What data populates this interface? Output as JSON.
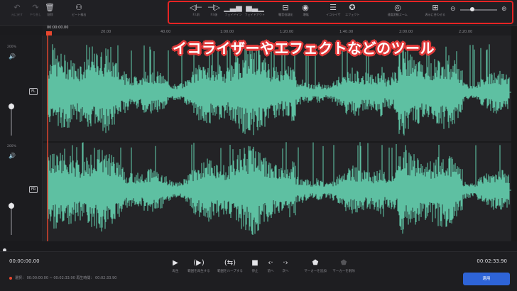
{
  "toolbar": {
    "left_buttons": [
      {
        "icon": "undo-icon",
        "label": "元に戻す",
        "glyph": "↶",
        "enabled": false
      },
      {
        "icon": "redo-icon",
        "label": "やり直し",
        "glyph": "↷",
        "enabled": false
      },
      {
        "icon": "delete-icon",
        "label": "削除",
        "glyph": "🗑",
        "enabled": true
      },
      {
        "icon": "beat-detect-icon",
        "label": "ビート検出",
        "glyph": "⚇",
        "enabled": true
      }
    ],
    "tools": [
      {
        "icon": "fade-in-icon",
        "label": "F.I.前",
        "glyph": "◁⊢"
      },
      {
        "icon": "fade-out-icon",
        "label": "F.I.後",
        "glyph": "⊣▷"
      },
      {
        "icon": "fade-in-curve-icon",
        "label": "フェイドイン",
        "glyph": "▁▃▅"
      },
      {
        "icon": "fade-out-curve-icon",
        "label": "フェイドアウト",
        "glyph": "▅▃▁"
      },
      {
        "icon": "noise-reduce-icon",
        "label": "騒音低減化",
        "glyph": "⊟"
      },
      {
        "icon": "amplify-icon",
        "label": "増幅",
        "glyph": "◉"
      },
      {
        "icon": "equalizer-icon",
        "label": "イコライザ",
        "glyph": "☰"
      },
      {
        "icon": "effect-icon",
        "label": "エフェクト",
        "glyph": "✪"
      },
      {
        "icon": "pitch-icon",
        "label": "速度変動ズーム",
        "glyph": "◎"
      },
      {
        "icon": "fit-icon",
        "label": "表示に合わせる",
        "glyph": "⊞"
      }
    ],
    "zoom": {
      "minus": "⊖",
      "plus": "⊕",
      "level": 0.3
    }
  },
  "callout": "イコライザーやエフェクトなどのツール",
  "ruler": {
    "start": "00:00:00.00",
    "ticks": [
      "20.00",
      "40.00",
      "1:00.00",
      "1:20.00",
      "1:40.00",
      "2:00.00",
      "2:20.00"
    ]
  },
  "channels": [
    {
      "pct": "200%",
      "badge": "FL",
      "volume_icon": "speaker-icon"
    },
    {
      "pct": "200%",
      "badge": "FR",
      "volume_icon": "speaker-icon"
    }
  ],
  "colors": {
    "waveform": "#5ec0a2",
    "playhead": "#e8472f",
    "highlight_box": "#e62424",
    "apply": "#2e64d8"
  },
  "transport": {
    "current_time": "00:00:00.00",
    "total_time": "00:02:33.90",
    "selection_info": "選択： 00:00:00.00 ~ 00:02:33.90 再生時間： 00:02:33.90",
    "buttons": [
      {
        "icon": "play-icon",
        "label": "再生",
        "glyph": "▶",
        "enabled": true
      },
      {
        "icon": "play-selection-icon",
        "label": "範囲を再生する",
        "glyph": "(▶)",
        "enabled": true
      },
      {
        "icon": "loop-selection-icon",
        "label": "範囲をループする",
        "glyph": "(⇆)",
        "enabled": true
      },
      {
        "icon": "stop-icon",
        "label": "停止",
        "glyph": "■",
        "enabled": true
      },
      {
        "icon": "previous-icon",
        "label": "前へ",
        "glyph": "‹·",
        "enabled": true
      },
      {
        "icon": "next-icon",
        "label": "次へ",
        "glyph": "·›",
        "enabled": true
      },
      {
        "icon": "add-marker-icon",
        "label": "マーカーを追加",
        "glyph": "⬟",
        "enabled": true
      },
      {
        "icon": "remove-marker-icon",
        "label": "マーカーを削除",
        "glyph": "⬟",
        "enabled": false
      }
    ],
    "apply_label": "適用"
  }
}
